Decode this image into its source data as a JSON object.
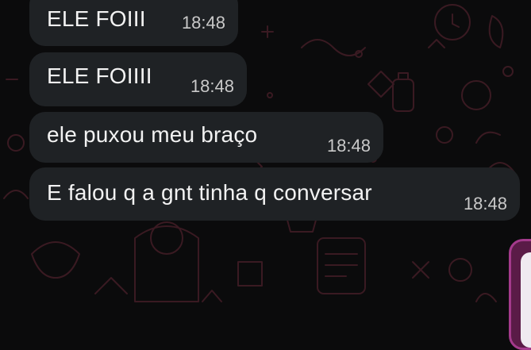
{
  "chat": {
    "messages": [
      {
        "text": "ELE FOIII",
        "time": "18:48"
      },
      {
        "text": "ELE FOIIII",
        "time": "18:48"
      },
      {
        "text": "ele puxou meu braço",
        "time": "18:48"
      },
      {
        "text": "E falou q a gnt tinha q conversar",
        "time": "18:48"
      }
    ]
  },
  "colors": {
    "background": "#0b0b0c",
    "wallpaper_doodle": "#3a1a22",
    "bubble": "#1f2225",
    "message_text": "#f2f2f2",
    "timestamp": "#c9c9c9",
    "accent_sent": "#a43a8c"
  }
}
